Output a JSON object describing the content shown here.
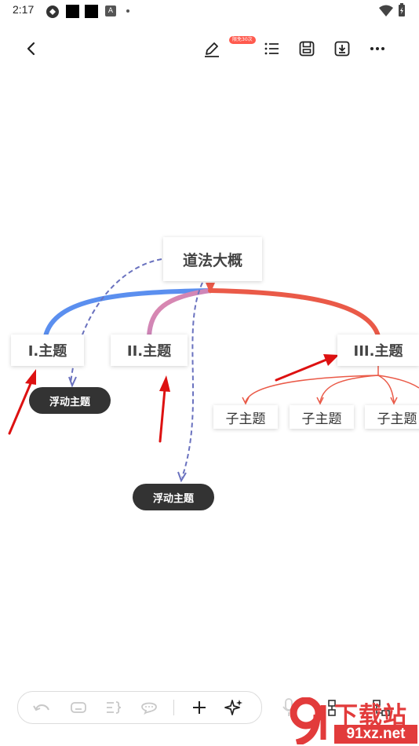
{
  "status_bar": {
    "time": "2:17",
    "icons": [
      "app-icon",
      "notification-square-icon",
      "notification-square-icon",
      "text-a-icon",
      "dot-icon",
      "wifi-icon",
      "battery-icon"
    ]
  },
  "toolbar": {
    "back_icon": "chevron-left-icon",
    "badge": "限免30次",
    "tools": [
      "edit-pen-icon",
      "outline-list-icon",
      "save-icon",
      "download-icon",
      "more-icon"
    ]
  },
  "mindmap": {
    "root": "道法大概",
    "topics": [
      "I.主题",
      "II.主题",
      "III.主题"
    ],
    "subtopics": [
      "子主题",
      "子主题",
      "子主题"
    ],
    "floating": [
      "浮动主题",
      "浮动主题"
    ],
    "colors": {
      "blue_branch": "#5b8fef",
      "pink_branch": "#cc7fb5",
      "red_branch": "#ea5a48",
      "dashed": "#6a72bf",
      "arrow": "#dd1111"
    }
  },
  "bottom_bar": {
    "tools": [
      "undo-icon",
      "keyboard-icon",
      "bracket-icon",
      "comment-icon",
      "add-icon",
      "sparkle-icon"
    ],
    "extra": [
      "microphone-icon",
      "layout-icon",
      "structure-icon"
    ]
  },
  "watermark": {
    "text": "下载站",
    "sub": "91xz.net"
  }
}
